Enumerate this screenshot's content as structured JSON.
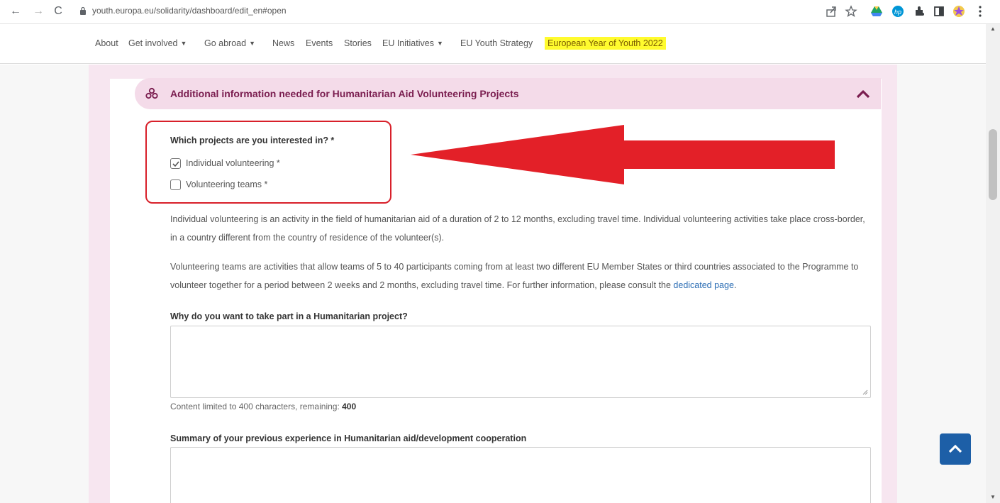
{
  "browser": {
    "url": "youth.europa.eu/solidarity/dashboard/edit_en#open",
    "back": "←",
    "forward": "→",
    "reload": "C"
  },
  "nav": {
    "items": [
      {
        "label": "About"
      },
      {
        "label": "Get involved"
      },
      {
        "label": "Go abroad"
      },
      {
        "label": "News"
      },
      {
        "label": "Events"
      },
      {
        "label": "Stories"
      },
      {
        "label": "EU Initiatives"
      },
      {
        "label": "EU Youth Strategy"
      },
      {
        "label": "European Year of Youth 2022"
      }
    ],
    "caret": "▼"
  },
  "section": {
    "title": "Additional information needed for Humanitarian Aid Volunteering Projects"
  },
  "form": {
    "projects_question": "Which projects are you interested in? *",
    "options": [
      {
        "label": "Individual volunteering *",
        "checked": true
      },
      {
        "label": "Volunteering teams *",
        "checked": false
      }
    ],
    "para1": "Individual volunteering is an activity in the field of humanitarian aid of a duration of 2 to 12 months, excluding travel time. Individual volunteering activities take place cross-border, in a country different from the country of residence of the volunteer(s).",
    "para2_text": "Volunteering teams are activities that allow teams of 5 to 40 participants coming from at least two different EU Member States or third countries associated to the Programme to volunteer together for a period between 2 weeks and 2 months, excluding travel time. For further information, please consult the ",
    "para2_link": "dedicated page",
    "para2_end": ".",
    "why_question": "Why do you want to take part in a Humanitarian project?",
    "why_value": "",
    "limit_text": "Content limited to 400 characters, remaining: ",
    "limit_remaining": "400",
    "summary_question": "Summary of your previous experience in Humanitarian aid/development cooperation",
    "summary_value": ""
  },
  "colors": {
    "accent": "#7a1d4f",
    "highlight": "#fffb2e",
    "annotation": "#d8202a",
    "button": "#1d5fa7"
  }
}
